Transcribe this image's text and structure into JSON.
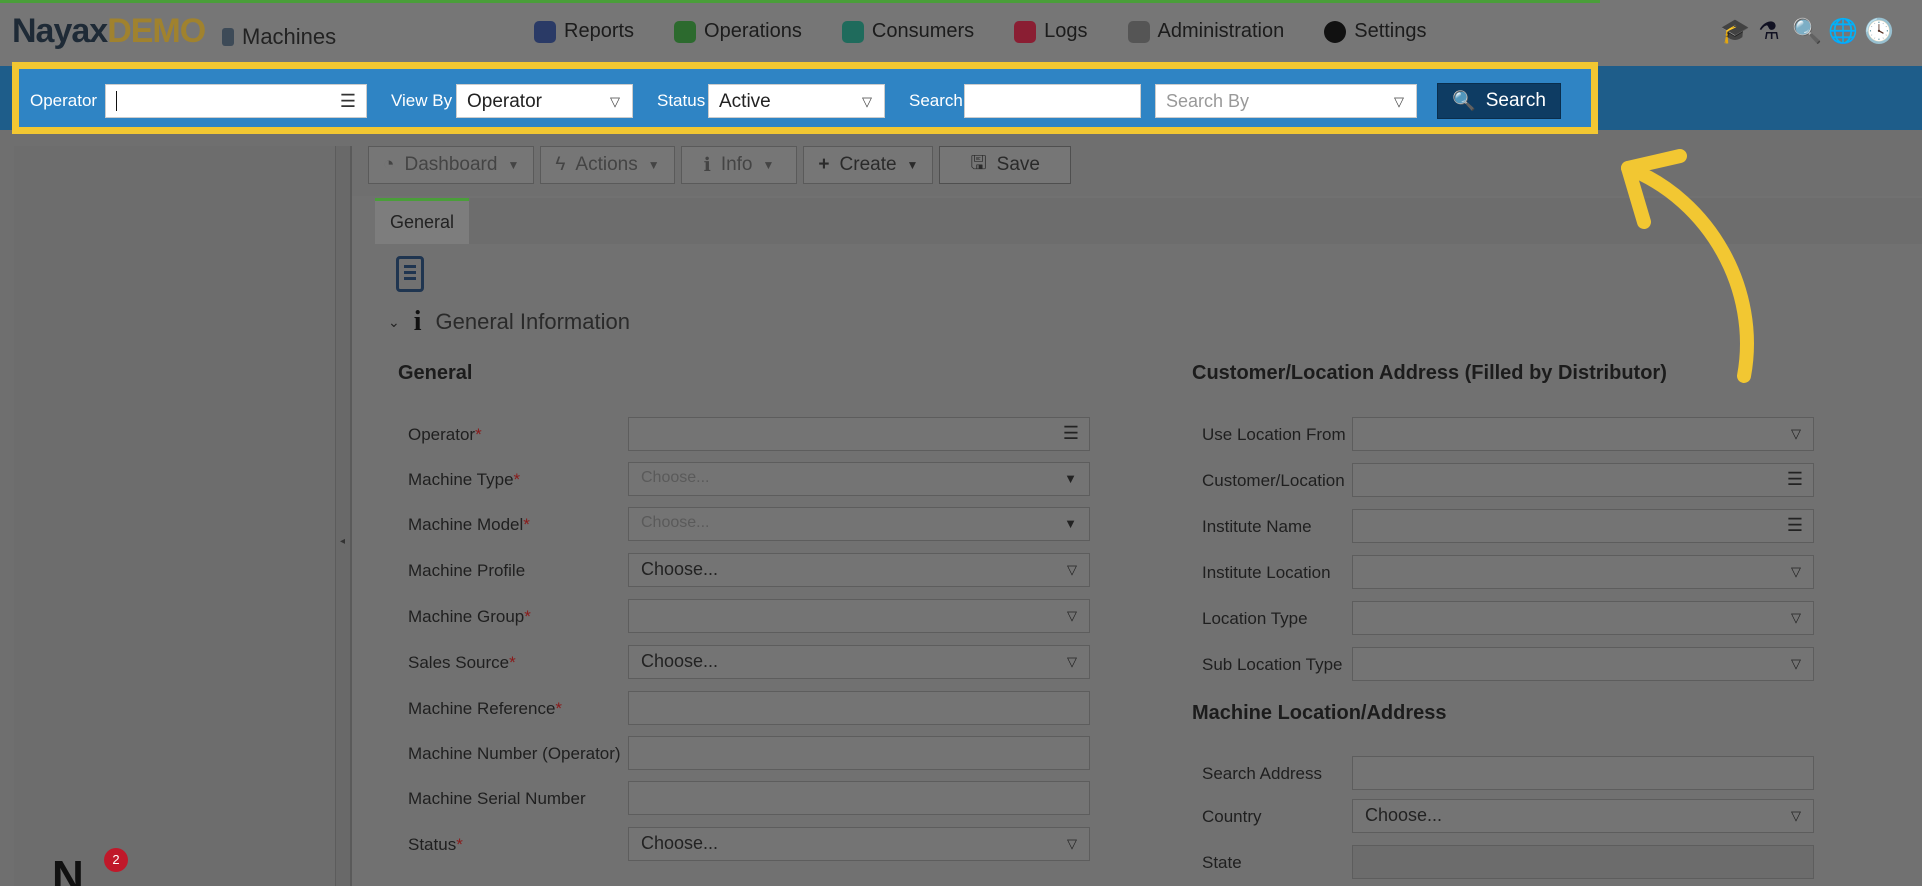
{
  "header": {
    "logo_main": "Nayax",
    "logo_suffix": "DEMO",
    "module_title": "Machines"
  },
  "nav": [
    {
      "label": "Reports",
      "icon": "reports-icon"
    },
    {
      "label": "Operations",
      "icon": "operations-icon"
    },
    {
      "label": "Consumers",
      "icon": "consumers-icon"
    },
    {
      "label": "Logs",
      "icon": "logs-icon"
    },
    {
      "label": "Administration",
      "icon": "administration-icon"
    },
    {
      "label": "Settings",
      "icon": "settings-icon"
    }
  ],
  "top_icons": [
    "graduation-cap-icon",
    "flask-icon",
    "search-icon",
    "globe-icon",
    "clock-icon"
  ],
  "filter": {
    "operator_label": "Operator",
    "operator_value": "",
    "viewby_label": "View By",
    "viewby_value": "Operator",
    "status_label": "Status",
    "status_value": "Active",
    "search_label": "Search",
    "search_value": "",
    "searchby_placeholder": "Search By",
    "search_button": "Search"
  },
  "toolbar": {
    "dashboard": "Dashboard",
    "actions": "Actions",
    "info": "Info",
    "create": "Create",
    "save": "Save"
  },
  "tabs": {
    "general": "General"
  },
  "section": {
    "title": "General Information"
  },
  "general_group": {
    "title": "General",
    "fields": [
      {
        "label": "Operator",
        "required": true,
        "value": "",
        "kind": "list"
      },
      {
        "label": "Machine Type",
        "required": true,
        "value": "Choose...",
        "kind": "select-disabled"
      },
      {
        "label": "Machine Model",
        "required": true,
        "value": "Choose...",
        "kind": "select-disabled"
      },
      {
        "label": "Machine Profile",
        "required": false,
        "value": "Choose...",
        "kind": "select"
      },
      {
        "label": "Machine Group",
        "required": true,
        "value": "",
        "kind": "select"
      },
      {
        "label": "Sales Source",
        "required": true,
        "value": "Choose...",
        "kind": "select"
      },
      {
        "label": "Machine Reference",
        "required": true,
        "value": "",
        "kind": "text"
      },
      {
        "label": "Machine Number (Operator)",
        "required": false,
        "value": "",
        "kind": "text"
      },
      {
        "label": "Machine Serial Number",
        "required": false,
        "value": "",
        "kind": "text"
      },
      {
        "label": "Status",
        "required": true,
        "value": "Choose...",
        "kind": "select"
      }
    ]
  },
  "customer_group": {
    "title": "Customer/Location Address (Filled by Distributor)",
    "fields": [
      {
        "label": "Use Location From",
        "value": "",
        "kind": "select"
      },
      {
        "label": "Customer/Location",
        "value": "",
        "kind": "list"
      },
      {
        "label": "Institute Name",
        "value": "",
        "kind": "list"
      },
      {
        "label": "Institute Location",
        "value": "",
        "kind": "select"
      },
      {
        "label": "Location Type",
        "value": "",
        "kind": "select"
      },
      {
        "label": "Sub Location Type",
        "value": "",
        "kind": "select"
      }
    ]
  },
  "machine_location_group": {
    "title": "Machine Location/Address",
    "fields": [
      {
        "label": "Search Address",
        "value": "",
        "kind": "text"
      },
      {
        "label": "Country",
        "value": "Choose...",
        "kind": "select"
      },
      {
        "label": "State",
        "value": "",
        "kind": "text-disabled"
      }
    ]
  },
  "notifications": {
    "count": "2"
  }
}
